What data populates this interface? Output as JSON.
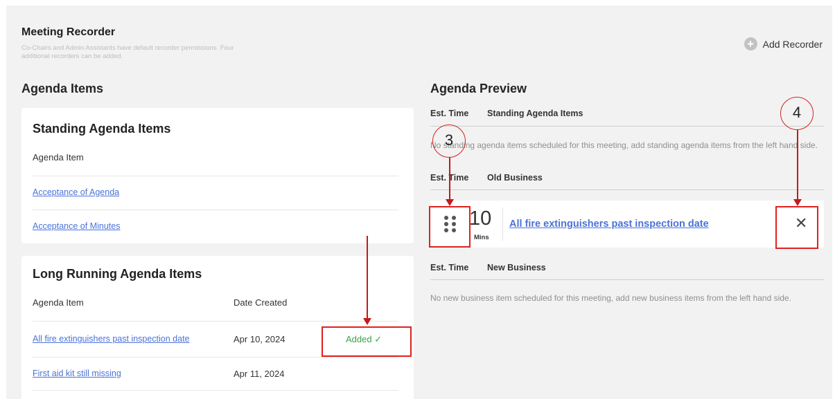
{
  "header": {
    "title": "Meeting Recorder",
    "description": "Co-Chairs and Admin Assistants have default recorder permissions. Four additional recorders can be added.",
    "add_recorder_label": "Add Recorder"
  },
  "agenda_items": {
    "title": "Agenda Items",
    "standing": {
      "title": "Standing Agenda Items",
      "col_agenda_item": "Agenda Item",
      "rows": [
        "Acceptance of Agenda",
        "Acceptance of Minutes"
      ]
    },
    "long_running": {
      "title": "Long Running Agenda Items",
      "col_agenda_item": "Agenda Item",
      "col_date_created": "Date Created",
      "rows": [
        {
          "item": "All fire extinguishers past inspection date",
          "date": "Apr 10, 2024",
          "status": "Added"
        },
        {
          "item": "First aid kit still missing",
          "date": "Apr 11, 2024",
          "status": ""
        }
      ]
    }
  },
  "agenda_preview": {
    "title": "Agenda Preview",
    "sections": [
      {
        "est_time_label": "Est. Time",
        "name": "Standing Agenda Items",
        "empty_message": "No standing agenda items scheduled for this meeting, add standing agenda items from the left hand side."
      },
      {
        "est_time_label": "Est. Time",
        "name": "Old Business"
      },
      {
        "est_time_label": "Est. Time",
        "name": "New Business",
        "empty_message": "No new business item scheduled for this meeting, add new business items from the left hand side."
      }
    ],
    "scheduled_item": {
      "time_value": "10",
      "time_unit": "Mins",
      "title": "All fire extinguishers past inspection date"
    }
  },
  "annotations": {
    "callout_3": "3",
    "callout_4": "4",
    "annotation_color": "#e0201e"
  },
  "colors": {
    "link": "#4a72d8",
    "added": "#3aa34a",
    "background": "#f2f2f2"
  }
}
